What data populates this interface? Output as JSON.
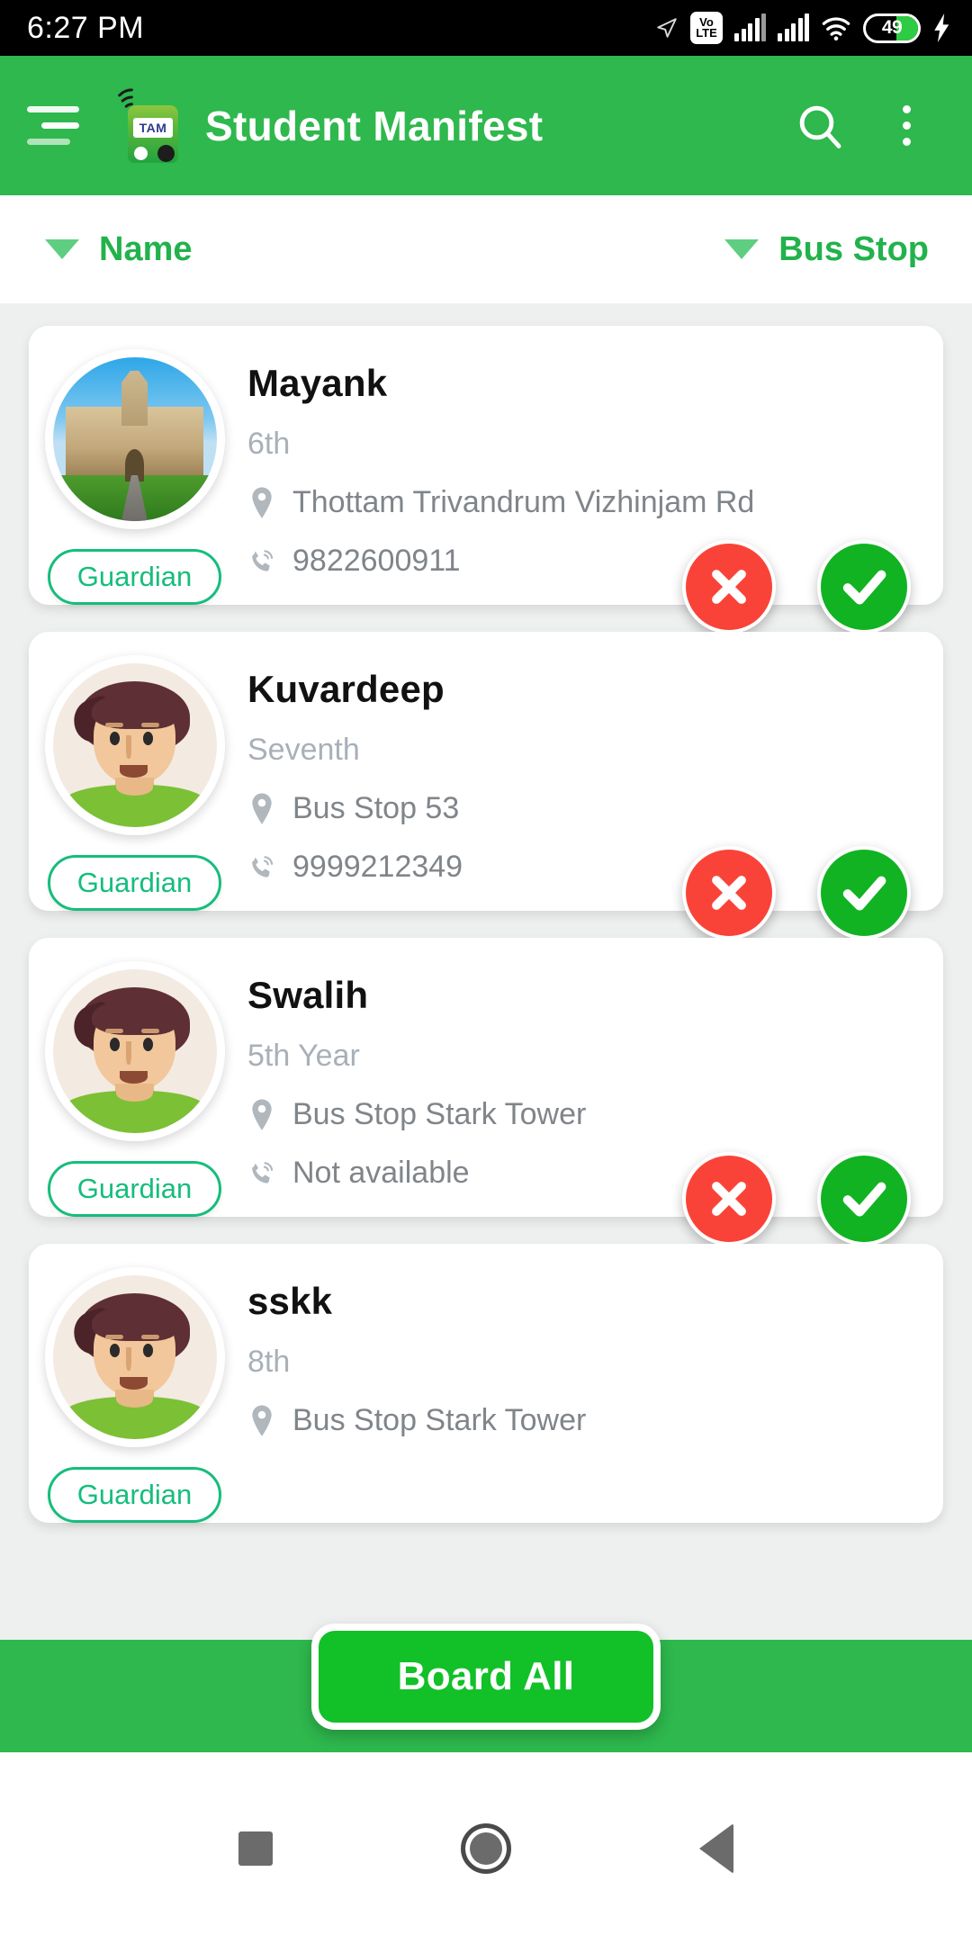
{
  "statusbar": {
    "time": "6:27 PM",
    "icons": [
      "location-arrow-icon",
      "volte-icon",
      "signal-bars-icon",
      "signal-bars-icon",
      "wifi-icon",
      "battery-icon",
      "charging-bolt-icon"
    ],
    "volte_top": "Vo",
    "volte_bottom": "LTE",
    "battery_percent": "49"
  },
  "toolbar": {
    "menu_icon": "hamburger-menu-icon",
    "logo_icon": "bus-app-logo-icon",
    "logo_text": "TAM",
    "title": "Student Manifest",
    "search_icon": "search-icon",
    "overflow_icon": "more-vertical-icon",
    "accent_color": "#2eb84d"
  },
  "sortbar": {
    "left": {
      "caret_icon": "caret-down-icon",
      "label": "Name"
    },
    "right": {
      "caret_icon": "caret-down-icon",
      "label": "Bus Stop"
    },
    "label_color": "#22b24c"
  },
  "students": [
    {
      "name": "Mayank",
      "grade": "6th",
      "stop": "Thottam  Trivandrum Vizhinjam Rd",
      "phone": "9822600911",
      "badge": "Guardian",
      "avatar": "photo",
      "location_icon": "location-pin-icon",
      "phone_icon": "phone-call-icon",
      "reject_icon": "cross-circle-icon",
      "accept_icon": "check-circle-icon"
    },
    {
      "name": "Kuvardeep",
      "grade": "Seventh",
      "stop": "Bus Stop 53",
      "phone": "9999212349",
      "badge": "Guardian",
      "avatar": "illustration",
      "location_icon": "location-pin-icon",
      "phone_icon": "phone-call-icon",
      "reject_icon": "cross-circle-icon",
      "accept_icon": "check-circle-icon"
    },
    {
      "name": "Swalih",
      "grade": "5th Year",
      "stop": "Bus Stop Stark Tower",
      "phone": "Not available",
      "badge": "Guardian",
      "avatar": "illustration",
      "location_icon": "location-pin-icon",
      "phone_icon": "phone-call-icon",
      "reject_icon": "cross-circle-icon",
      "accept_icon": "check-circle-icon"
    },
    {
      "name": "sskk",
      "grade": "8th",
      "stop": "Bus Stop Stark Tower",
      "phone": "",
      "badge": "Guardian",
      "avatar": "illustration",
      "location_icon": "location-pin-icon",
      "phone_icon": "phone-call-icon",
      "reject_icon": "cross-circle-icon",
      "accept_icon": "check-circle-icon"
    }
  ],
  "bottombar": {
    "board_all_label": "Board All",
    "button_color": "#12c028",
    "bar_color": "#2eb84d"
  },
  "navbar": {
    "recents_icon": "recents-square-icon",
    "home_icon": "home-circle-icon",
    "back_icon": "back-triangle-icon"
  }
}
